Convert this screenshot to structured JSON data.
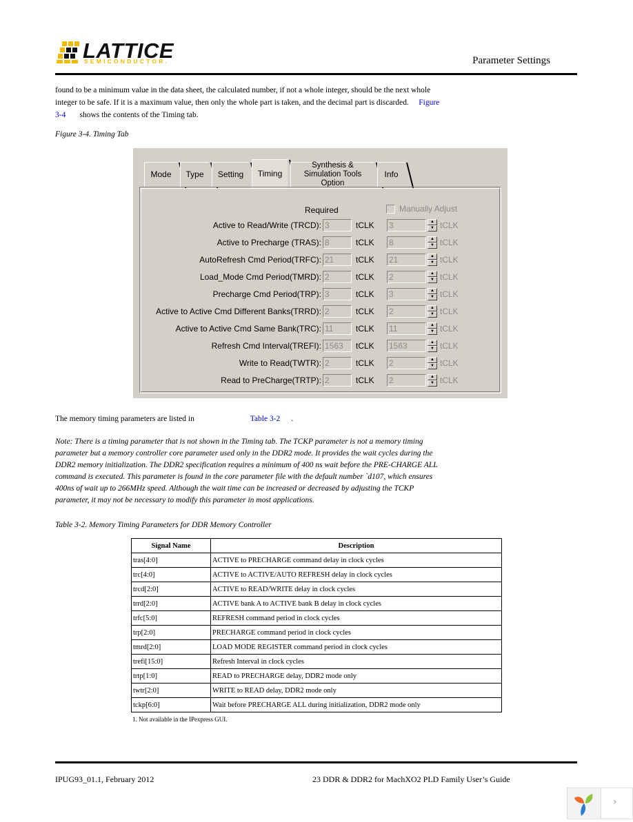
{
  "header": {
    "logo_word": "LATTICE",
    "logo_sub": "SEMICONDUCTOR.",
    "section_title": "Parameter Settings",
    "logo_color": "#f5b800"
  },
  "intro": {
    "text_before_link": "found to be a minimum value in the data sheet, the calculated number, if not a whole integer, should be the next whole integer to be safe. If it is a maximum value, then only the whole part is taken, and the decimal part is discarded.",
    "link": "Figure 3-4",
    "text_after_link": "shows the contents of the Timing tab."
  },
  "figure_caption": "Figure 3-4. Timing Tab",
  "dialog": {
    "tabs": [
      {
        "label": "Mode",
        "active": false
      },
      {
        "label": "Type",
        "active": false
      },
      {
        "label": "Setting",
        "active": false
      },
      {
        "label": "Timing",
        "active": true
      },
      {
        "label": "Synthesis & Simulation Tools Option",
        "active": false
      },
      {
        "label": "Info",
        "active": false
      }
    ],
    "required_header": "Required",
    "manual_adjust_label": "Manually Adjust",
    "manual_adjust_checked": false,
    "unit": "tCLK",
    "rows": [
      {
        "label": "Active to Read/Write (TRCD):",
        "required": "3",
        "manual": "3"
      },
      {
        "label": "Active to Precharge (TRAS):",
        "required": "8",
        "manual": "8"
      },
      {
        "label": "AutoRefresh Cmd Period(TRFC):",
        "required": "21",
        "manual": "21"
      },
      {
        "label": "Load_Mode Cmd Period(TMRD):",
        "required": "2",
        "manual": "2"
      },
      {
        "label": "Precharge Cmd Period(TRP):",
        "required": "3",
        "manual": "3"
      },
      {
        "label": "Active to Active Cmd Different Banks(TRRD):",
        "required": "2",
        "manual": "2"
      },
      {
        "label": "Active to Active Cmd Same Bank(TRC):",
        "required": "11",
        "manual": "11"
      },
      {
        "label": "Refresh Cmd Interval(TREFI):",
        "required": "1563",
        "manual": "1563"
      },
      {
        "label": "Write to Read(TWTR):",
        "required": "2",
        "manual": "2"
      },
      {
        "label": "Read to PreCharge(TRTP):",
        "required": "2",
        "manual": "2"
      }
    ]
  },
  "sentence2": {
    "text": "The memory timing parameters are listed in",
    "link": "Table 3-2",
    "end": "."
  },
  "note": "Note: There is a timing parameter that is not shown in the Timing tab. The TCKP parameter is not a memory timing parameter but a memory controller core parameter used only in the DDR2 mode. It provides the wait cycles during the DDR2 memory initialization. The DDR2 specification requires a minimum of 400 ns wait before the PRE-CHARGE ALL command is executed. This parameter is found in the core parameter file with the default number `d107, which ensures 400ns of wait up to 266MHz speed. Although the wait time can be increased or decreased by adjusting the TCKP parameter, it may not be necessary to modify this parameter in most applications.",
  "table_caption": "Table 3-2. Memory Timing Parameters for DDR Memory Controller",
  "table": {
    "headers": [
      "Signal Name",
      "Description"
    ],
    "rows": [
      [
        "tras[4:0]",
        "ACTIVE to PRECHARGE command delay in clock cycles"
      ],
      [
        "trc[4:0]",
        "ACTIVE to ACTIVE/AUTO REFRESH delay in clock cycles"
      ],
      [
        "trcd[2:0]",
        "ACTIVE to READ/WRITE delay in clock cycles"
      ],
      [
        "trrd[2:0]",
        "ACTIVE bank A to ACTIVE bank B delay in clock cycles"
      ],
      [
        "trfc[5:0]",
        "REFRESH command period in clock cycles"
      ],
      [
        "trp[2:0]",
        "PRECHARGE command period in clock cycles"
      ],
      [
        "tmrd[2:0]",
        "LOAD MODE REGISTER command period in clock cycles"
      ],
      [
        "trefi[15:0]",
        "Refresh Interval in clock cycles"
      ],
      [
        "trtp[1:0]",
        "READ to PRECHARGE delay, DDR2 mode only"
      ],
      [
        "twtr[2:0]",
        "WRITE to READ delay, DDR2 mode only"
      ],
      [
        "tckp[6:0]",
        "Wait before PRECHARGE ALL during initialization, DDR2 mode only"
      ]
    ],
    "footnote": "1. Not available in the IPexpress GUI."
  },
  "footer": {
    "left": "IPUG93_01.1, February 2012",
    "right": "23 DDR & DDR2 for MachXO2 PLD Family User’s Guide"
  },
  "widget": {
    "next_icon": "chevron-right-icon",
    "next_glyph": "›"
  }
}
